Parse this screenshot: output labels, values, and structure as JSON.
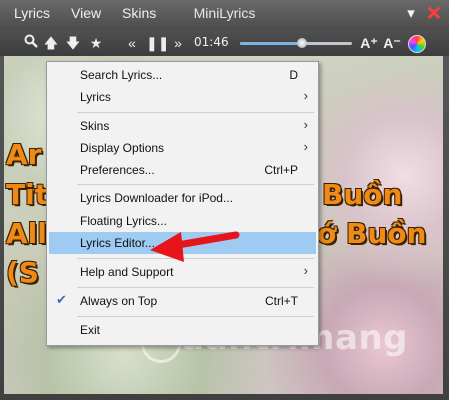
{
  "menubar": {
    "lyrics": "Lyrics",
    "view": "View",
    "skins": "Skins"
  },
  "window": {
    "title": "MiniLyrics",
    "minimize": "▾",
    "close": "✕"
  },
  "toolbar": {
    "time": "01:46",
    "progress_percent": 55,
    "font_up": "A⁺",
    "font_down": "A⁻"
  },
  "lyrics_lines": [
    "Ar",
    "Tit",
    "All",
    "(S"
  ],
  "lyrics_right": [
    "Buồn",
    "ớ Buồn"
  ],
  "watermark": "uantrimang",
  "context_menu": [
    {
      "label": "Search Lyrics...",
      "shortcut": "D"
    },
    {
      "label": "Lyrics",
      "submenu": "›"
    },
    {
      "label": "Skins",
      "submenu": "›"
    },
    {
      "label": "Display Options",
      "submenu": "›"
    },
    {
      "label": "Preferences...",
      "shortcut": "Ctrl+P"
    },
    {
      "label": "Lyrics Downloader for iPod..."
    },
    {
      "label": "Floating Lyrics..."
    },
    {
      "label": "Lyrics Editor..."
    },
    {
      "label": "Help and Support",
      "submenu": "›"
    },
    {
      "label": "Always on Top",
      "shortcut": "Ctrl+T",
      "checked": "✔"
    },
    {
      "label": "Exit"
    }
  ],
  "colors": {
    "highlight": "#9fcaf2",
    "lyric": "#f08a16",
    "arrow": "#e8141c",
    "close": "#ff3b3b"
  },
  "icons": [
    "search-icon",
    "up-arrow-icon",
    "down-arrow-icon",
    "star-icon",
    "previous-icon",
    "pause-icon",
    "next-icon",
    "font-increase-icon",
    "font-decrease-icon",
    "color-wheel-icon"
  ]
}
